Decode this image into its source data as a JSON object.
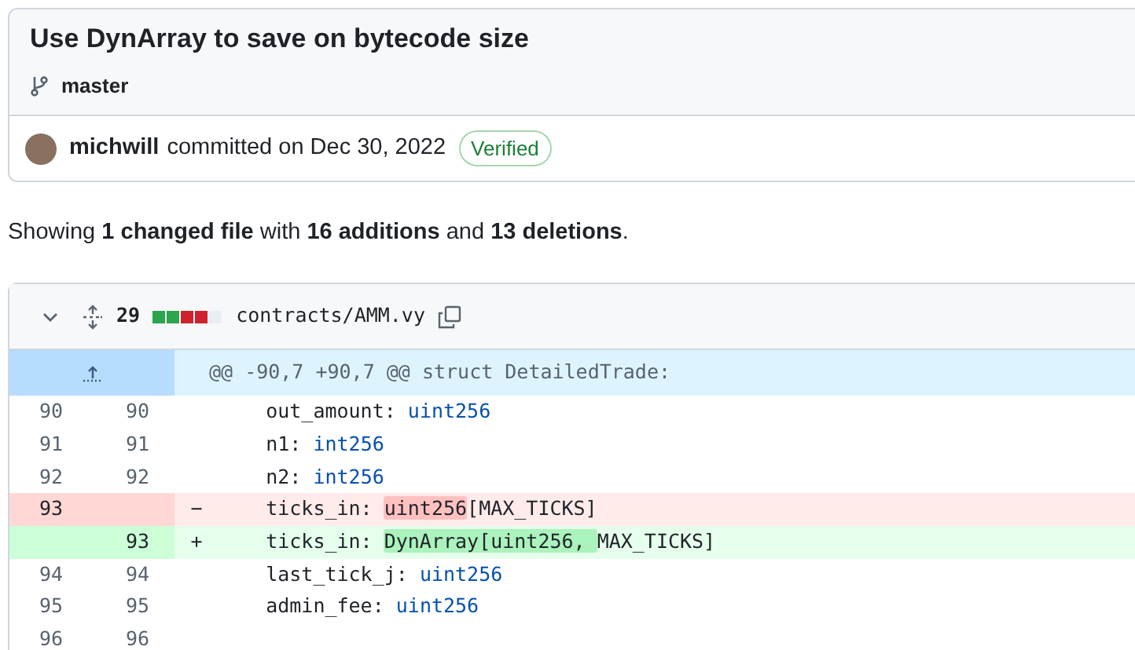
{
  "commit": {
    "title": "Use DynArray to save on bytecode size",
    "branch": "master",
    "author": "michwill",
    "action": "committed on Dec 30, 2022",
    "badge": "Verified"
  },
  "summary": "Showing **1 changed file** with **16 additions** and **13 deletions**.",
  "file": {
    "expanded": true,
    "changes": "29",
    "diffstat": [
      {
        "color": "#2da44e"
      },
      {
        "color": "#2da44e"
      },
      {
        "color": "#cf222e"
      },
      {
        "color": "#cf222e"
      },
      {
        "color": "#eaeef2"
      }
    ],
    "path": "contracts/AMM.vy",
    "hunk": "@@ -90,7 +90,7 @@ struct DetailedTrade:",
    "lines": [
      {
        "kind": "context",
        "old": "90",
        "new": "90",
        "code": [
          {
            "text": "    out_amount: ",
            "kind": "plain"
          },
          {
            "text": "uint256",
            "kind": "type"
          }
        ]
      },
      {
        "kind": "context",
        "old": "91",
        "new": "91",
        "code": [
          {
            "text": "    n1: ",
            "kind": "plain"
          },
          {
            "text": "int256",
            "kind": "type"
          }
        ]
      },
      {
        "kind": "context",
        "old": "92",
        "new": "92",
        "code": [
          {
            "text": "    n2: ",
            "kind": "plain"
          },
          {
            "text": "int256",
            "kind": "type"
          }
        ]
      },
      {
        "kind": "del",
        "old": "93",
        "sign": "−",
        "code": [
          {
            "text": "    ticks_in: ",
            "kind": "plain"
          },
          {
            "text": "uint256",
            "kind": "changed"
          },
          {
            "text": "[MAX_TICKS]",
            "kind": "plain"
          }
        ]
      },
      {
        "kind": "add",
        "new": "93",
        "sign": "+",
        "code": [
          {
            "text": "    ticks_in: ",
            "kind": "plain"
          },
          {
            "text": "DynArray[uint256, ",
            "kind": "changed"
          },
          {
            "text": "MAX_TICKS]",
            "kind": "plain"
          }
        ]
      },
      {
        "kind": "context",
        "old": "94",
        "new": "94",
        "code": [
          {
            "text": "    last_tick_j: ",
            "kind": "plain"
          },
          {
            "text": "uint256",
            "kind": "type"
          }
        ]
      },
      {
        "kind": "context",
        "old": "95",
        "new": "95",
        "code": [
          {
            "text": "    admin_fee: ",
            "kind": "plain"
          },
          {
            "text": "uint256",
            "kind": "type"
          }
        ]
      },
      {
        "kind": "context",
        "old": "96",
        "new": "96"
      }
    ]
  }
}
